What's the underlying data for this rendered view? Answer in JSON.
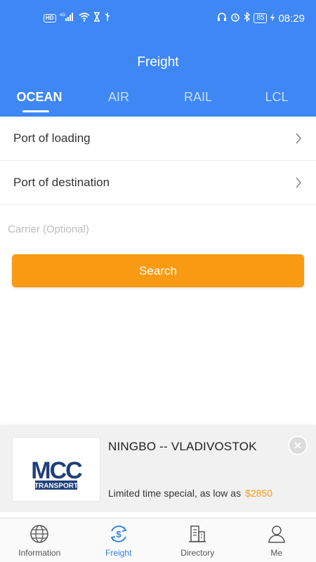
{
  "status_bar": {
    "hd_badge": "HD",
    "network": "4G",
    "battery": "85",
    "time": "08:29"
  },
  "header": {
    "title": "Freight",
    "tabs": [
      {
        "label": "OCEAN",
        "active": true
      },
      {
        "label": "AIR",
        "active": false
      },
      {
        "label": "RAIL",
        "active": false
      },
      {
        "label": "LCL",
        "active": false
      }
    ]
  },
  "form": {
    "port_of_loading": "Port of loading",
    "port_of_destination": "Port of destination",
    "carrier_placeholder": "Carrier (Optional)",
    "carrier_value": "",
    "search_label": "Search"
  },
  "promo": {
    "logo_text_top": "MCC",
    "logo_text_bottom": "TRANSPORT",
    "route": "NINGBO -- VLADIVOSTOK",
    "text": "Limited time special, as low as",
    "price": "$2850"
  },
  "bottom_nav": {
    "items": [
      {
        "label": "Information",
        "icon": "globe-icon",
        "active": false
      },
      {
        "label": "Freight",
        "icon": "dollar-refresh-icon",
        "active": true
      },
      {
        "label": "Directory",
        "icon": "buildings-icon",
        "active": false
      },
      {
        "label": "Me",
        "icon": "user-icon",
        "active": false
      }
    ]
  },
  "colors": {
    "header_blue": "#3E87F4",
    "search_orange": "#F89B13",
    "price_orange": "#F59A1A",
    "nav_active_blue": "#2F80ED"
  }
}
